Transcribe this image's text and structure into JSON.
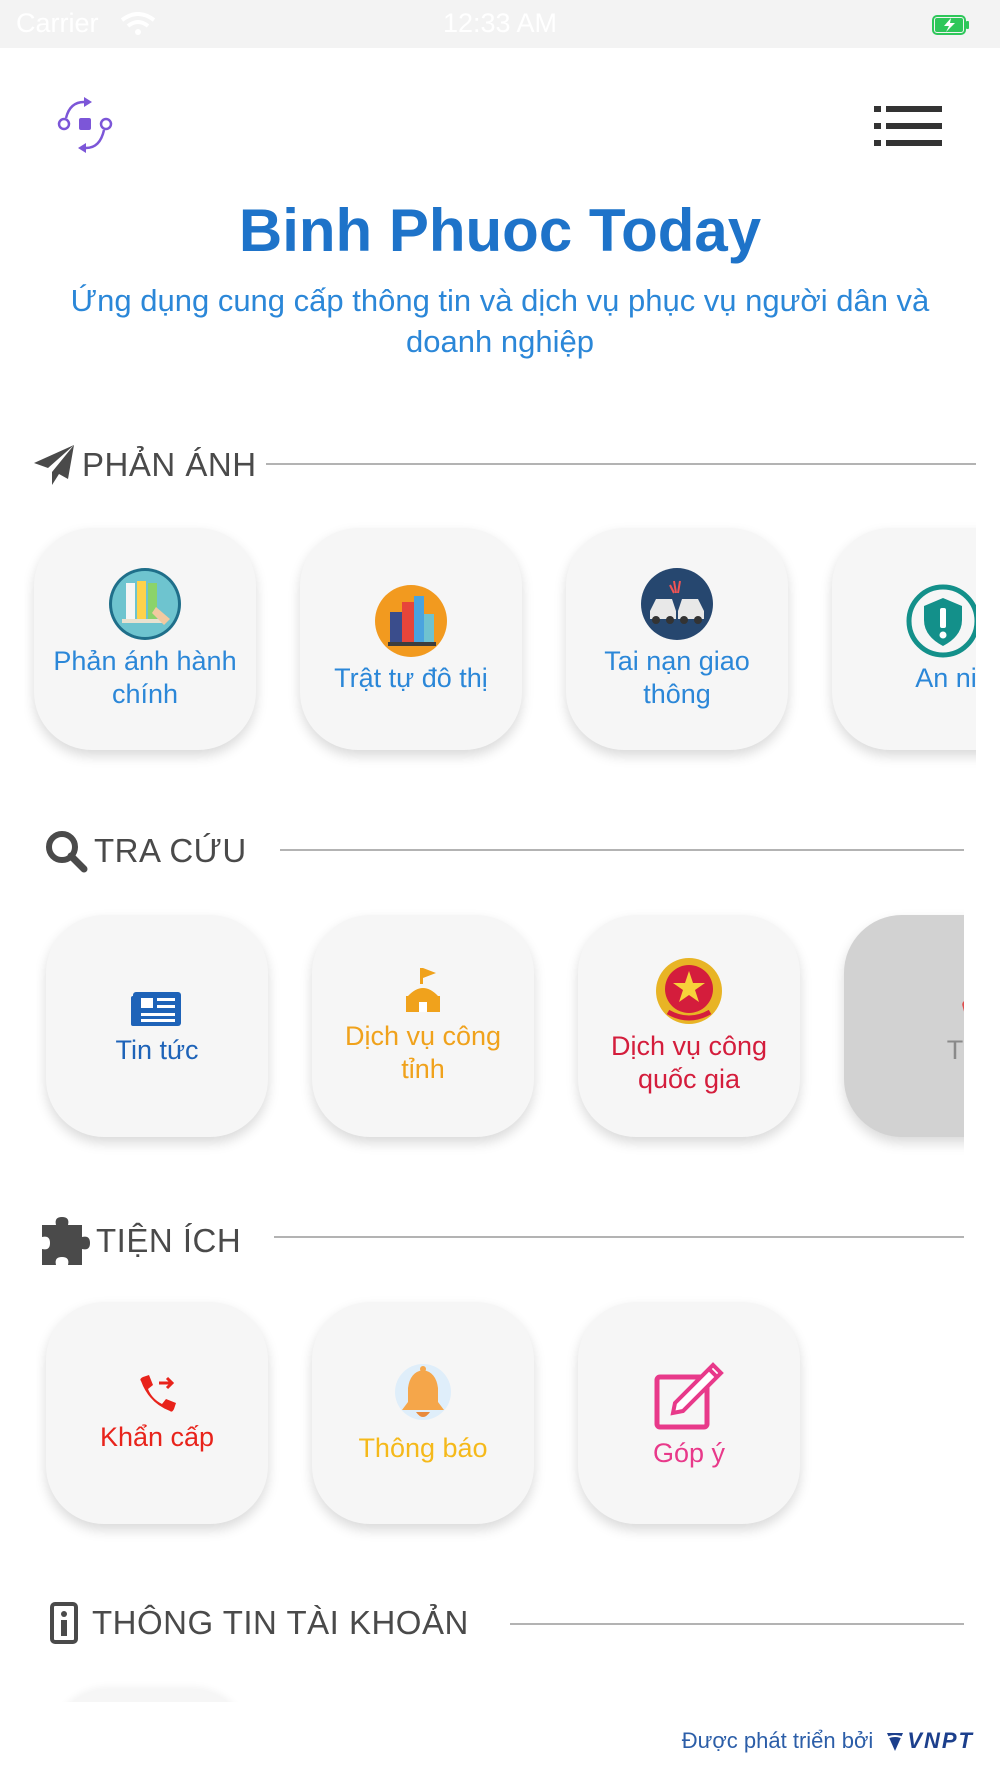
{
  "status_bar": {
    "carrier": "Carrier",
    "time": "12:33 AM"
  },
  "header": {
    "title": "Binh Phuoc Today",
    "subtitle": "Ứng dụng cung cấp thông tin và dịch vụ phục vụ người dân và doanh nghiệp",
    "logo_icon": "app-logo-icon",
    "menu_icon": "list-menu-icon"
  },
  "sections": {
    "phan_anh": {
      "title": "PHẢN ÁNH",
      "icon": "paper-plane-icon",
      "items": [
        {
          "label": "Phản ánh hành chính",
          "icon": "folders-icon",
          "color": "#2b87d8"
        },
        {
          "label": "Trật tự đô thị",
          "icon": "city-icon",
          "color": "#2b87d8"
        },
        {
          "label": "Tai nạn giao thông",
          "icon": "car-crash-icon",
          "color": "#2b87d8"
        },
        {
          "label": "An ninh tr",
          "icon": "shield-icon",
          "color": "#2b87d8"
        }
      ]
    },
    "tra_cuu": {
      "title": "TRA CỨU",
      "icon": "search-icon",
      "items": [
        {
          "label": "Tin tức",
          "icon": "newspaper-icon",
          "color": "#1e63b8"
        },
        {
          "label": "Dịch vụ công tỉnh",
          "icon": "government-building-icon",
          "color": "#f0a21c"
        },
        {
          "label": "Dịch vụ công quốc gia",
          "icon": "national-emblem-icon",
          "color": "#d41d3c"
        },
        {
          "label": "Thanh",
          "icon": "payment-card-icon",
          "color": "#8a8a8a"
        }
      ]
    },
    "tien_ich": {
      "title": "TIỆN ÍCH",
      "icon": "puzzle-icon",
      "items": [
        {
          "label": "Khẩn cấp",
          "icon": "emergency-phone-icon",
          "color": "#e8231b"
        },
        {
          "label": "Thông báo",
          "icon": "bell-icon",
          "color": "#f5b91a"
        },
        {
          "label": "Góp ý",
          "icon": "feedback-edit-icon",
          "color": "#e8398a"
        }
      ]
    },
    "tai_khoan": {
      "title": "THÔNG TIN TÀI KHOẢN",
      "icon": "account-info-icon"
    }
  },
  "footer": {
    "text": "Được phát triển bởi",
    "brand": "VNPT"
  }
}
